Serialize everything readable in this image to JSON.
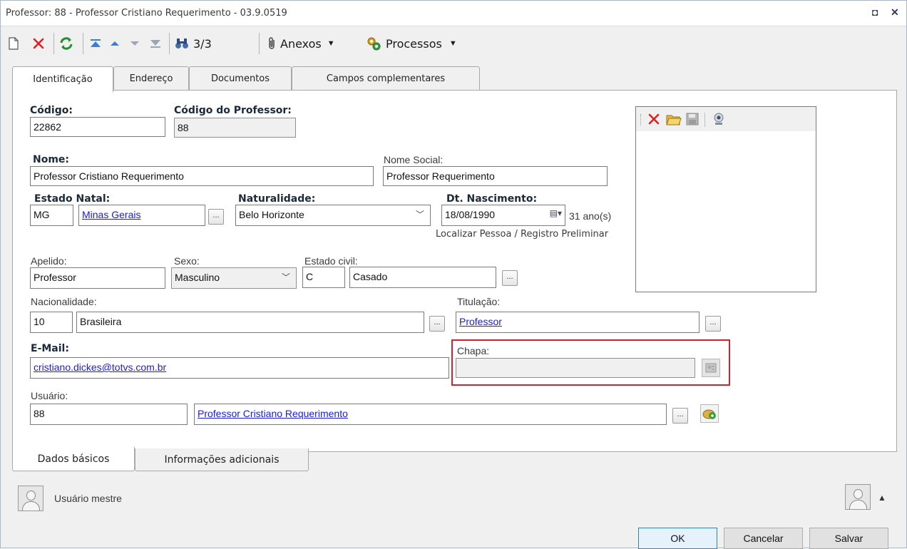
{
  "window": {
    "title": "Professor: 88 - Professor Cristiano Requerimento - 03.9.0519",
    "restore_glyph": "◘",
    "close_glyph": "✕"
  },
  "toolbar": {
    "record_counter": "3/3",
    "anexos_label": "Anexos",
    "processos_label": "Processos",
    "icons": [
      "new-icon",
      "delete-icon",
      "refresh-icon",
      "first-record-icon",
      "previous-record-icon",
      "next-record-icon",
      "last-record-icon",
      "binoculars-icon",
      "paperclip-icon",
      "processes-icon"
    ]
  },
  "tabs": {
    "top": [
      "Identificação",
      "Endereço",
      "Documentos",
      "Campos complementares"
    ],
    "bottom": [
      "Dados básicos",
      "Informações adicionais"
    ]
  },
  "form": {
    "codigo": {
      "label": "Código:",
      "value": "22862"
    },
    "codigo_professor": {
      "label": "Código do Professor:",
      "value": "88"
    },
    "nome": {
      "label": "Nome:",
      "value": "Professor Cristiano Requerimento"
    },
    "nome_social": {
      "label": "Nome Social:",
      "value": "Professor Requerimento"
    },
    "estado_natal": {
      "label": "Estado Natal:",
      "code": "MG",
      "name": "Minas Gerais"
    },
    "naturalidade": {
      "label": "Naturalidade:",
      "value": "Belo Horizonte"
    },
    "nascimento": {
      "label": "Dt. Nascimento:",
      "value": "18/08/1990",
      "age": "31 ano(s)"
    },
    "localizar_pessoa": "Localizar Pessoa / Registro Preliminar",
    "apelido": {
      "label": "Apelido:",
      "value": "Professor"
    },
    "sexo": {
      "label": "Sexo:",
      "value": "Masculino"
    },
    "estado_civil": {
      "label": "Estado civil:",
      "code": "C",
      "name": "Casado"
    },
    "nacionalidade": {
      "label": "Nacionalidade:",
      "code": "10",
      "name": "Brasileira"
    },
    "titulacao": {
      "label": "Titulação:",
      "value": "Professor"
    },
    "email": {
      "label": "E-Mail:",
      "value": "cristiano.dickes@totvs.com.br"
    },
    "chapa": {
      "label": "Chapa:",
      "value": ""
    },
    "usuario": {
      "label": "Usuário:",
      "code": "88",
      "name": "Professor Cristiano Requerimento"
    },
    "ellipsis": "..."
  },
  "footer": {
    "user_label": "Usuário mestre",
    "ok_label": "OK",
    "cancel_label": "Cancelar",
    "save_label": "Salvar"
  },
  "colors": {
    "highlight": "#d6202e",
    "link": "#1a1ae0",
    "delete": "#e02020"
  }
}
